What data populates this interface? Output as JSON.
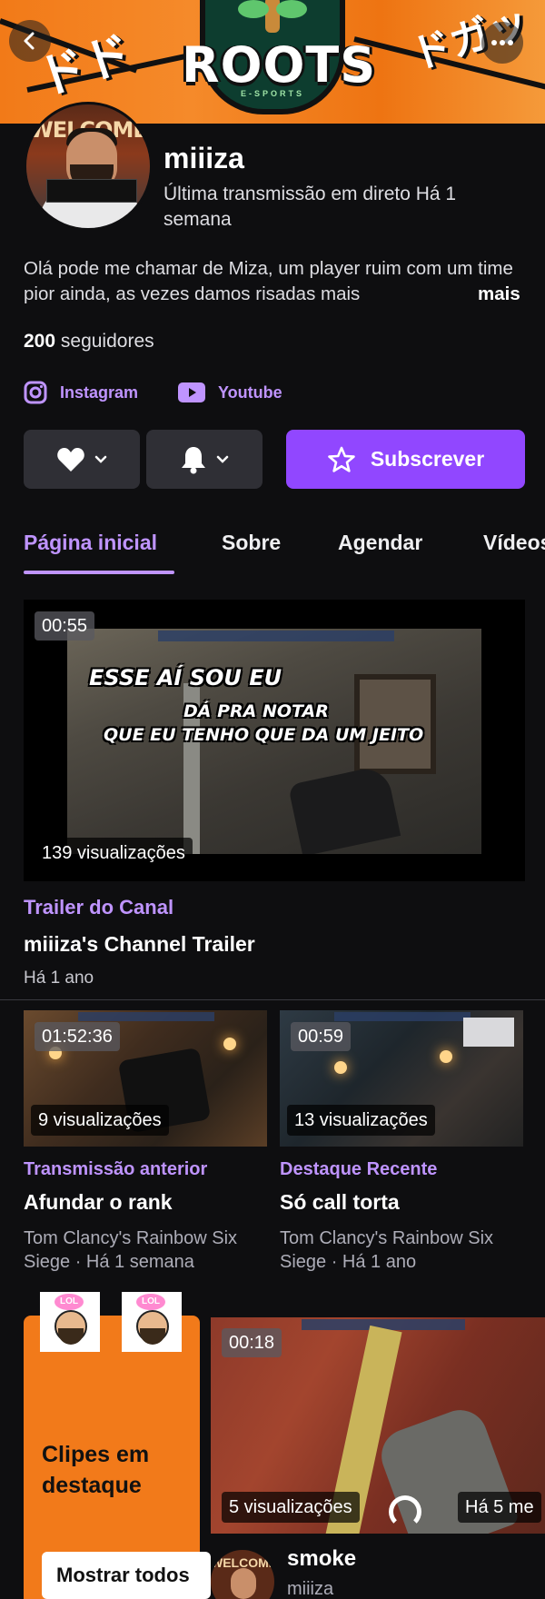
{
  "banner": {
    "logo_text": "ROOTS",
    "logo_sub": "E-SPORTS",
    "deco_left": "ドド",
    "deco_right": "ドガッ",
    "back_icon": "chevron-left-icon",
    "more_icon": "more-horizontal-icon"
  },
  "avatar_text": "WELCOME",
  "channel": {
    "name": "miiiza",
    "last_live": "Última transmissão em direto Há 1 semana",
    "bio": "Olá pode me chamar de Miza, um player ruim com um time pior ainda, as vezes damos risadas mais",
    "bio_more": "mais",
    "followers_count": "200",
    "followers_label": "seguidores"
  },
  "social": {
    "instagram": "Instagram",
    "youtube": "Youtube"
  },
  "actions": {
    "follow_icon": "heart-icon",
    "notify_icon": "bell-icon",
    "subscribe": "Subscrever"
  },
  "tabs": [
    {
      "label": "Página inicial",
      "active": true
    },
    {
      "label": "Sobre",
      "active": false
    },
    {
      "label": "Agendar",
      "active": false
    },
    {
      "label": "Vídeos",
      "active": false
    }
  ],
  "trailer": {
    "duration": "00:55",
    "views": "139 visualizações",
    "overlay_line1": "ESSE AÍ SOU EU",
    "overlay_line2": "DÁ PRA NOTAR",
    "overlay_line3": "QUE EU TENHO QUE DA UM JEITO",
    "category": "Trailer do Canal",
    "title": "miiiza's Channel Trailer",
    "date": "Há 1 ano"
  },
  "videos": [
    {
      "duration": "01:52:36",
      "views": "9 visualizações",
      "category": "Transmissão anterior",
      "title": "Afundar o rank",
      "meta": "Tom Clancy's Rainbow Six Siege · Há 1 semana"
    },
    {
      "duration": "00:59",
      "views": "13 visualizações",
      "category": "Destaque Recente",
      "title": "Só call torta",
      "meta": "Tom Clancy's Rainbow Six Siege · Há 1 ano"
    }
  ],
  "clips": {
    "sticker_text": "LOL",
    "heading": "Clipes em destaque",
    "show_all": "Mostrar todos",
    "clip": {
      "duration": "00:18",
      "views": "5 visualizações",
      "ago": "Há 5 me",
      "title": "smoke",
      "channel": "miiiza"
    }
  },
  "colors": {
    "accent": "#9147ff",
    "accent_text": "#bf94ff",
    "background": "#0e0e10",
    "banner": "#f27a18",
    "clips_card": "#f27a1a"
  }
}
